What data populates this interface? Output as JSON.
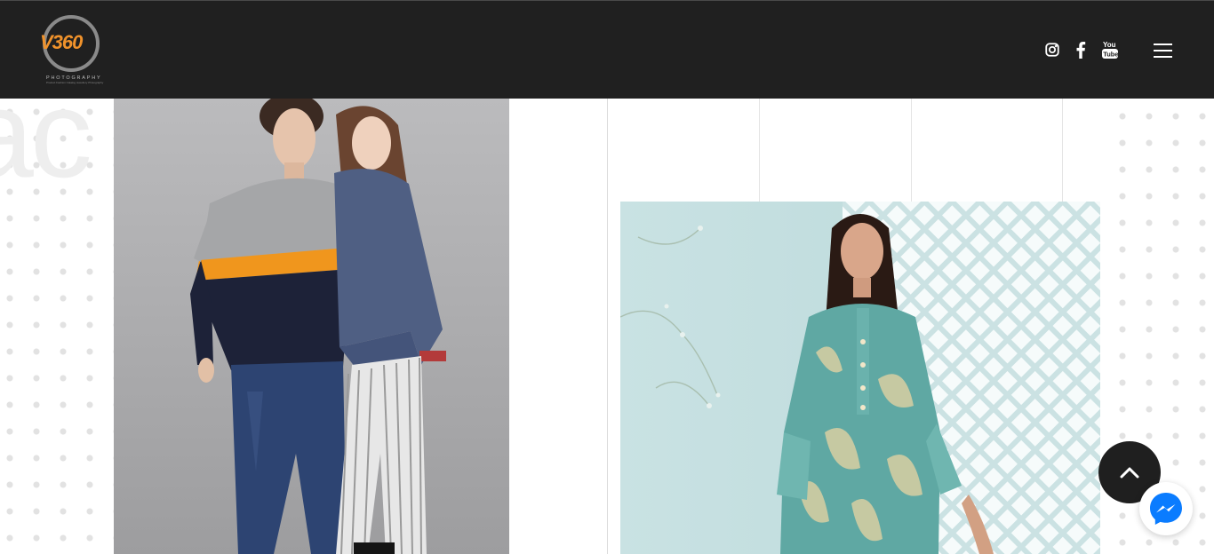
{
  "logo": {
    "text": "V360",
    "subtitle": "PHOTOGRAPHY",
    "tagline": "Product Fashion Catalog Jewellery Photography"
  },
  "header": {
    "social_icons": [
      "instagram-icon",
      "facebook-icon",
      "youtube-icon"
    ],
    "menu_icon": "hamburger-menu-icon",
    "background": "#202020"
  },
  "gallery": {
    "left_image": "couple-fashion-photo",
    "right_image": "kurta-fashion-photo"
  },
  "floating": {
    "scroll_top_icon": "chevron-up-icon",
    "messenger_icon": "messenger-icon"
  },
  "colors": {
    "accent": "#f0922b",
    "header_bg": "#202020",
    "messenger_blue": "#0a7cff"
  }
}
